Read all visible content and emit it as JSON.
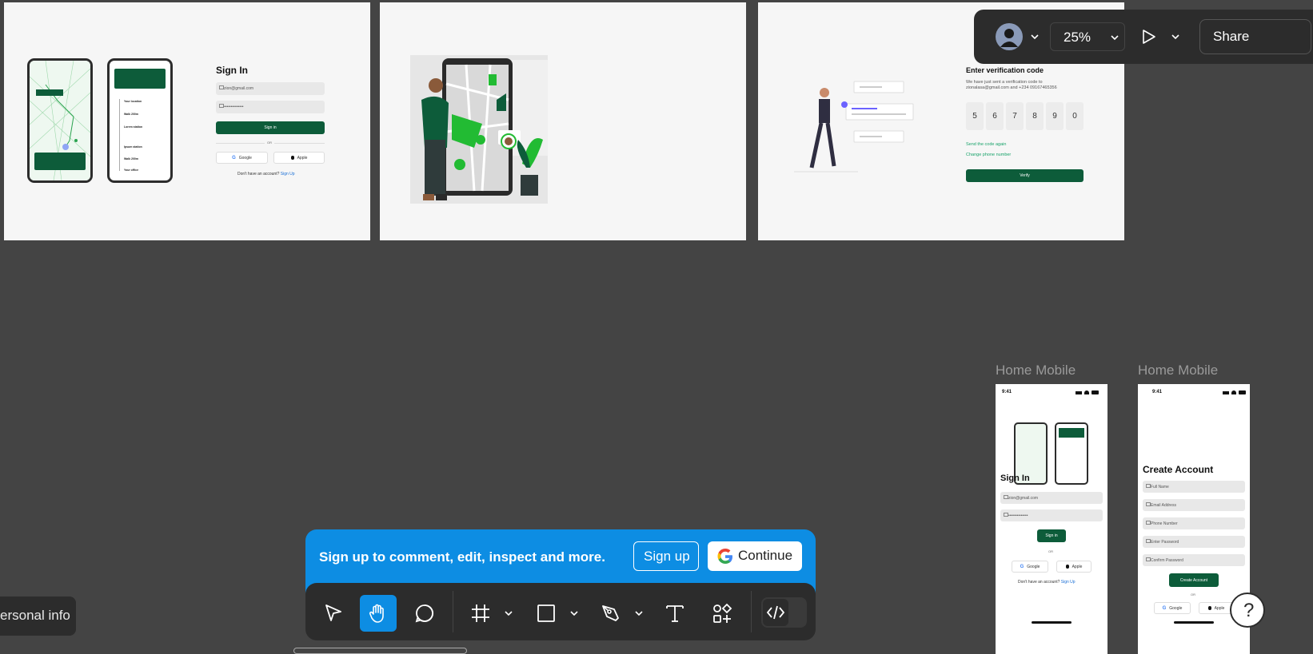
{
  "toolbar_top": {
    "zoom": "25%",
    "share_label": "Share",
    "avatar_icon": "user-avatar-icon",
    "present_icon": "play-icon"
  },
  "frame1": {
    "title": "Sign In",
    "email": "zion@gmail.com",
    "password": "••••••••••••••",
    "signin_label": "Sign in",
    "or": "OR",
    "google": "Google",
    "apple": "Apple",
    "no_account": "Don't have an account?",
    "signup_link": "Sign Up",
    "phone_items": [
      "Your location",
      "Walk 200m",
      "Lorem station",
      "Ipsum station",
      "Walk 200m",
      "Your office"
    ]
  },
  "frame3": {
    "title": "Enter verification code",
    "desc_line1": "We have just sent a verification code to",
    "desc_line2": "zionalasa@gmail.com and  +234 09167465356",
    "digits": [
      "5",
      "6",
      "7",
      "8",
      "9",
      "0"
    ],
    "send_again": "Send the code again",
    "change_phone": "Change phone number",
    "verify_label": "Verify"
  },
  "mobile1": {
    "label": "Home Mobile",
    "time": "9:41",
    "title": "Sign In",
    "email": "zion@gmail.com",
    "password": "••••••••••••••",
    "signin_label": "Sign in",
    "or": "OR",
    "google": "Google",
    "apple": "Apple",
    "no_account": "Don't have an account?",
    "signup_link": "Sign Up"
  },
  "mobile2": {
    "label": "Home Mobile",
    "time": "9:41",
    "title": "Create Account",
    "fields": [
      "Full Name",
      "Email Address",
      "Phone Number",
      "Enter Password",
      "Confirm Password"
    ],
    "create_label": "Create Account",
    "or": "OR",
    "google": "Google",
    "apple": "Apple"
  },
  "banner": {
    "text": "Sign up to comment, edit, inspect and more.",
    "signup_label": "Sign up",
    "continue_label": "Continue"
  },
  "bottom_tools": [
    "move-tool",
    "hand-tool",
    "comment-tool",
    "frame-tool",
    "shape-tool",
    "pen-tool",
    "text-tool",
    "components-tool",
    "dev-mode-toggle"
  ],
  "left_tooltip": "ersonal info",
  "help_label": "?",
  "colors": {
    "canvas": "#444444",
    "accent_blue": "#0d8de3",
    "brand_green": "#0d5c3a",
    "toolbar": "#2c2c2c"
  }
}
